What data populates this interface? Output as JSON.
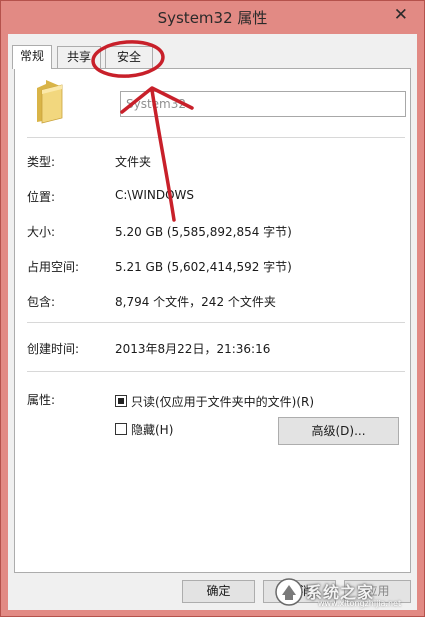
{
  "window": {
    "title": "System32 属性",
    "close_glyph": "✕"
  },
  "tabs": [
    {
      "label": "常规"
    },
    {
      "label": "共享"
    },
    {
      "label": "安全"
    }
  ],
  "general": {
    "name_value": "System32",
    "type": {
      "label": "类型:",
      "value": "文件夹"
    },
    "location": {
      "label": "位置:",
      "value": "C:\\WINDOWS"
    },
    "size": {
      "label": "大小:",
      "value": "5.20 GB (5,585,892,854 字节)"
    },
    "size_on_disk": {
      "label": "占用空间:",
      "value": "5.21 GB (5,602,414,592 字节)"
    },
    "contains": {
      "label": "包含:",
      "value": "8,794 个文件，242 个文件夹"
    },
    "created": {
      "label": "创建时间:",
      "value": "2013年8月22日，21:36:16"
    },
    "attributes": {
      "label": "属性:",
      "readonly": {
        "label": "只读(仅应用于文件夹中的文件)(R)",
        "state": "mixed"
      },
      "hidden": {
        "label": "隐藏(H)",
        "state": "unchecked"
      },
      "advanced_label": "高级(D)..."
    }
  },
  "footer": {
    "ok_label": "确定",
    "cancel_label": "取消",
    "apply_label": "应用"
  },
  "annotation": {
    "color": "#c8202a",
    "target": "tab-security"
  },
  "watermark": {
    "text": "系统之家",
    "url": "www.xitongzhijia.net"
  },
  "colors": {
    "titlebar": "#e28a84",
    "panel": "#ffffff",
    "client": "#f0f0f0"
  }
}
